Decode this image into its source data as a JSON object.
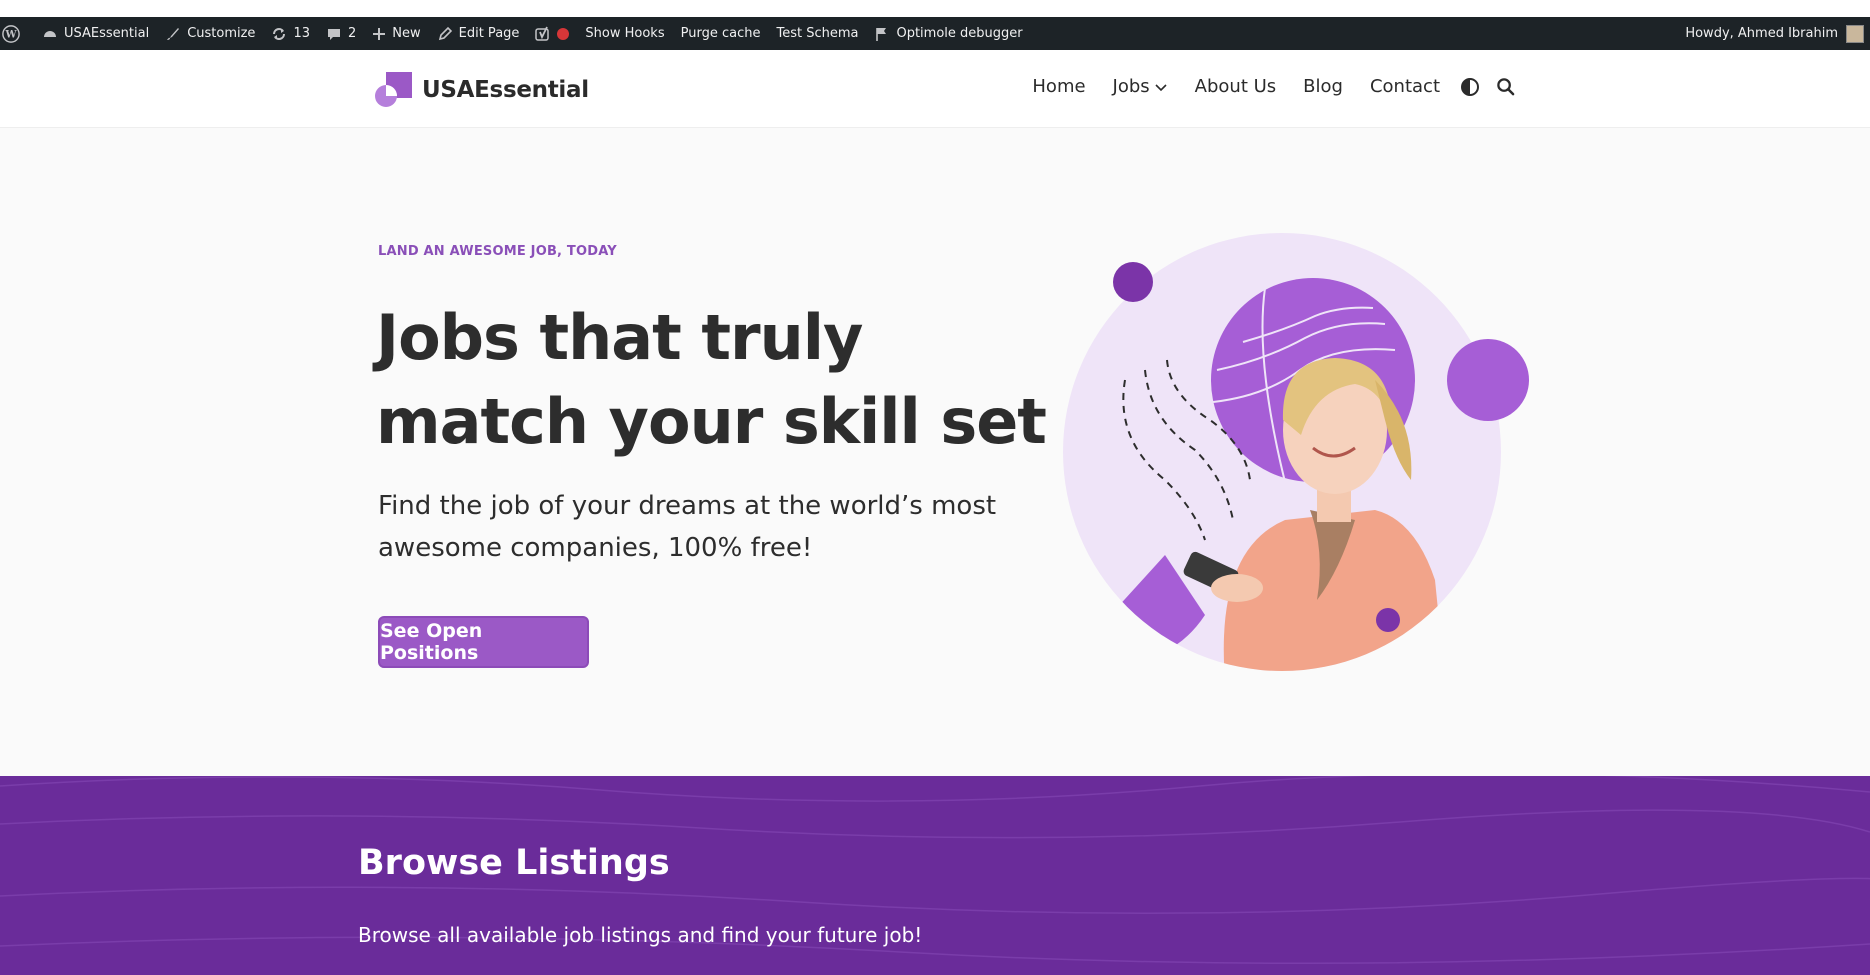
{
  "adminbar": {
    "site_name": "USAEssential",
    "customize": "Customize",
    "updates_count": "13",
    "comments_count": "2",
    "new": "New",
    "edit_page": "Edit Page",
    "show_hooks": "Show Hooks",
    "purge_cache": "Purge cache",
    "test_schema": "Test Schema",
    "optimole": "Optimole debugger",
    "howdy": "Howdy, Ahmed Ibrahim"
  },
  "header": {
    "logo_text": "USAEssential",
    "nav": {
      "home": "Home",
      "jobs": "Jobs",
      "about": "About Us",
      "blog": "Blog",
      "contact": "Contact"
    }
  },
  "hero": {
    "eyebrow": "LAND AN AWESOME JOB, TODAY",
    "headline": "Jobs that truly match your skill set",
    "subtext": "Find the job of your dreams at the world’s most awesome companies, 100% free!",
    "cta": "See Open Positions"
  },
  "browse": {
    "title": "Browse Listings",
    "subtitle": "Browse all available job listings and find your future job!"
  },
  "colors": {
    "accent": "#9b59c6",
    "accent_dark": "#6a2c9a",
    "eyebrow": "#8a4fb8",
    "adminbar_bg": "#1d2327",
    "text": "#2d2d2d"
  }
}
